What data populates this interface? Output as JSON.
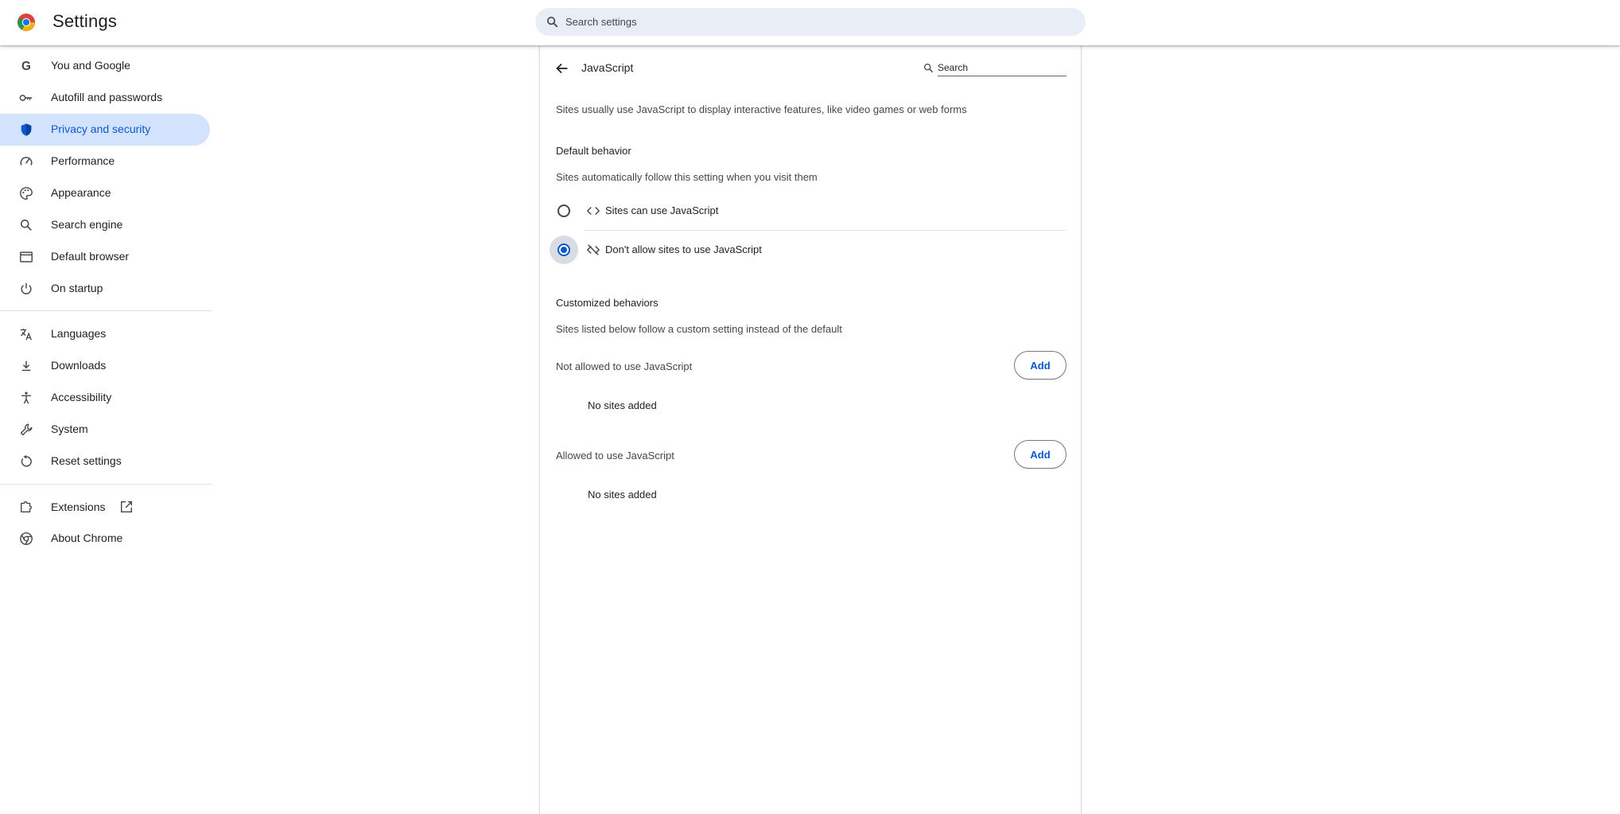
{
  "header": {
    "title": "Settings",
    "search_placeholder": "Search settings",
    "logo_icon": "chrome-logo"
  },
  "sidebar": {
    "active_color": "#d3e3fd",
    "items": [
      {
        "label": "You and Google",
        "icon": "google-g-icon"
      },
      {
        "label": "Autofill and passwords",
        "icon": "key-icon"
      },
      {
        "label": "Privacy and security",
        "icon": "shield-icon",
        "active": true
      },
      {
        "label": "Performance",
        "icon": "speedometer-icon"
      },
      {
        "label": "Appearance",
        "icon": "palette-icon"
      },
      {
        "label": "Search engine",
        "icon": "search-icon"
      },
      {
        "label": "Default browser",
        "icon": "browser-window-icon"
      },
      {
        "label": "On startup",
        "icon": "power-icon"
      },
      {
        "label": "Languages",
        "icon": "translate-icon"
      },
      {
        "label": "Downloads",
        "icon": "download-icon"
      },
      {
        "label": "Accessibility",
        "icon": "accessibility-icon"
      },
      {
        "label": "System",
        "icon": "wrench-icon"
      },
      {
        "label": "Reset settings",
        "icon": "reset-icon"
      },
      {
        "label": "Extensions",
        "icon": "puzzle-icon",
        "external": true
      },
      {
        "label": "About Chrome",
        "icon": "chrome-icon"
      }
    ]
  },
  "main": {
    "title": "JavaScript",
    "search_placeholder": "Search",
    "intro": "Sites usually use JavaScript to display interactive features, like video games or web forms",
    "default_behavior": {
      "heading": "Default behavior",
      "description": "Sites automatically follow this setting when you visit them",
      "options": [
        {
          "label": "Sites can use JavaScript",
          "icon": "code-icon",
          "checked": false
        },
        {
          "label": "Don't allow sites to use JavaScript",
          "icon": "code-off-icon",
          "checked": true
        }
      ]
    },
    "customized": {
      "heading": "Customized behaviors",
      "description": "Sites listed below follow a custom setting instead of the default",
      "lists": [
        {
          "label": "Not allowed to use JavaScript",
          "add_label": "Add",
          "empty": "No sites added"
        },
        {
          "label": "Allowed to use JavaScript",
          "add_label": "Add",
          "empty": "No sites added"
        }
      ]
    }
  },
  "colors": {
    "accent": "#0b57d0",
    "search_bg": "#e9eef6"
  }
}
